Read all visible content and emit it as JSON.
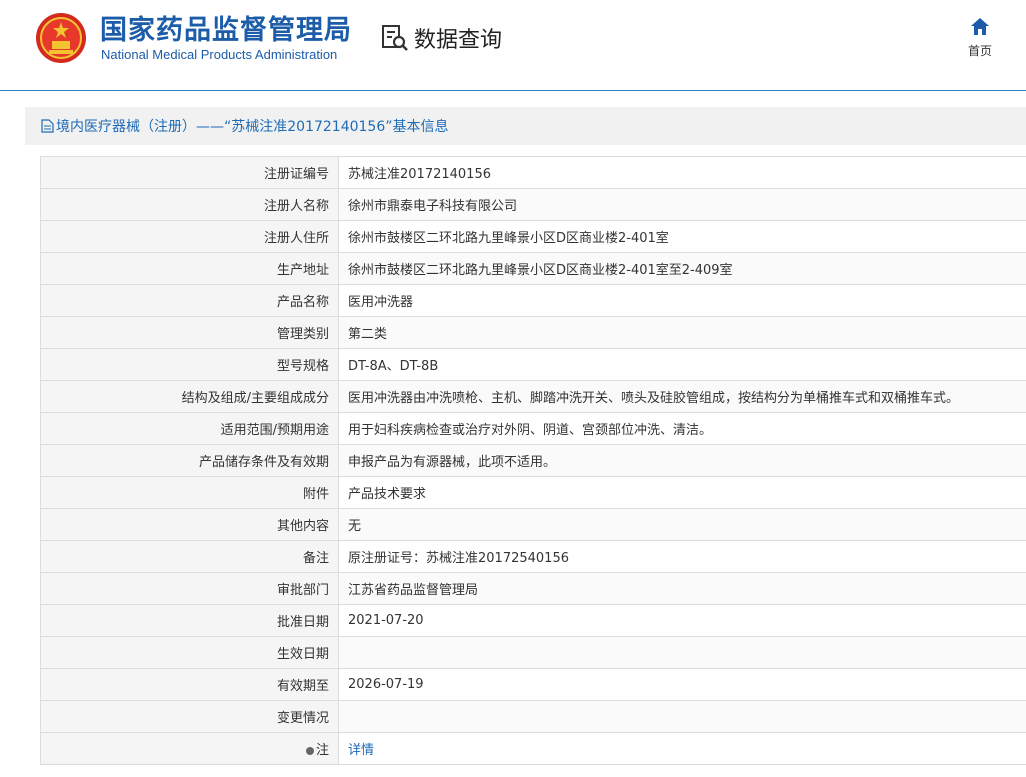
{
  "header": {
    "site_name_cn": "国家药品监督管理局",
    "site_name_en": "National Medical Products Administration",
    "query_title": "数据查询",
    "home_label": "首页",
    "icons": {
      "logo": "national-emblem-icon",
      "query": "search-document-icon",
      "home": "home-icon"
    },
    "colors": {
      "brand": "#1d5ca8",
      "divider": "#2f7ec9"
    }
  },
  "page": {
    "title": "境内医疗器械（注册）——“苏械注准20172140156”基本信息"
  },
  "rows": [
    {
      "label": "注册证编号",
      "value": "苏械注准20172140156"
    },
    {
      "label": "注册人名称",
      "value": "徐州市鼎泰电子科技有限公司"
    },
    {
      "label": "注册人住所",
      "value": "徐州市鼓楼区二环北路九里峰景小区D区商业楼2-401室"
    },
    {
      "label": "生产地址",
      "value": "徐州市鼓楼区二环北路九里峰景小区D区商业楼2-401室至2-409室"
    },
    {
      "label": "产品名称",
      "value": "医用冲洗器"
    },
    {
      "label": "管理类别",
      "value": "第二类"
    },
    {
      "label": "型号规格",
      "value": "DT-8A、DT-8B"
    },
    {
      "label": "结构及组成/主要组成成分",
      "value": "医用冲洗器由冲洗喷枪、主机、脚踏冲洗开关、喷头及硅胶管组成，按结构分为单桶推车式和双桶推车式。"
    },
    {
      "label": "适用范围/预期用途",
      "value": "用于妇科疾病检查或治疗对外阴、阴道、宫颈部位冲洗、清洁。"
    },
    {
      "label": "产品储存条件及有效期",
      "value": "申报产品为有源器械，此项不适用。"
    },
    {
      "label": "附件",
      "value": "产品技术要求"
    },
    {
      "label": "其他内容",
      "value": "无"
    },
    {
      "label": "备注",
      "value": "原注册证号：苏械注准20172540156"
    },
    {
      "label": "审批部门",
      "value": "江苏省药品监督管理局"
    },
    {
      "label": "批准日期",
      "value": "2021-07-20"
    },
    {
      "label": "生效日期",
      "value": ""
    },
    {
      "label": "有效期至",
      "value": "2026-07-19"
    },
    {
      "label": "变更情况",
      "value": ""
    }
  ],
  "note_row": {
    "label": "注",
    "link_text": "详情"
  }
}
